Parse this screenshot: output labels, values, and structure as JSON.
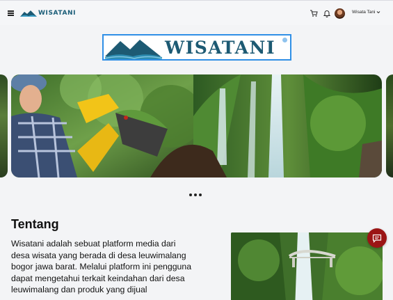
{
  "header": {
    "brand": "WISATANI",
    "user_name": "Wisata Tani"
  },
  "icons": {
    "menu": "hamburger-icon",
    "cart": "cart-icon",
    "notifications": "bell-icon",
    "user_dropdown": "chevron-down-icon",
    "chat": "chat-icon"
  },
  "hero": {
    "logo_text": "WISATANI"
  },
  "carousel": {
    "slides": [
      "farmer-picking-strawberries",
      "waterfall-in-forest"
    ],
    "dot_count": 3
  },
  "about": {
    "title": "Tentang",
    "body": "Wisatani adalah sebuat platform media dari desa wisata yang berada di desa leuwimalang bogor jawa barat. Melalui platform ini pengguna dapat mengetahui terkait keindahan dari desa leuwimalang dan produk yang dijual"
  },
  "colors": {
    "brand": "#1d5a73",
    "logo_border": "#2f8fe6",
    "chat_button": "#9b1515",
    "background": "#f3f4f6"
  }
}
